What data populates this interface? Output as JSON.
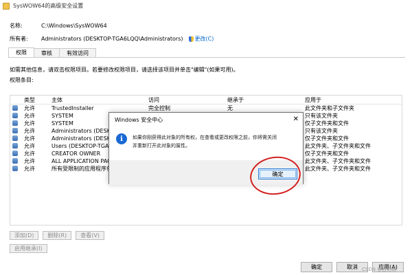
{
  "window": {
    "title": "SysWOW64的高级安全设置"
  },
  "props": {
    "name_label": "名称:",
    "name_value": "C:\\Windows\\SysWOW64",
    "owner_label": "所有者:",
    "owner_value": "Administrators (DESKTOP-TGA6LQQ\\Administrators)",
    "owner_change": "更改(C)"
  },
  "tabs": [
    "权限",
    "审核",
    "有效访问"
  ],
  "info_text": "如需其他信息，请双击权限项目。若要修改权限项目，请选择该项目并单击\"编辑\"(如果可用)。",
  "entries_label": "权限条目:",
  "table": {
    "headers": [
      "类型",
      "主体",
      "访问",
      "继承于",
      "应用于"
    ],
    "rows": [
      [
        "允许",
        "TrustedInstaller",
        "完全控制",
        "无",
        "此文件夹和子文件夹"
      ],
      [
        "允许",
        "SYSTEM",
        "",
        "",
        "只有该文件夹"
      ],
      [
        "允许",
        "SYSTEM",
        "",
        "",
        "仅子文件夹和文件"
      ],
      [
        "允许",
        "Administrators (DESKTOP-",
        "",
        "",
        "只有该文件夹"
      ],
      [
        "允许",
        "Administrators (DESKTOP-",
        "",
        "",
        "仅子文件夹和文件"
      ],
      [
        "允许",
        "Users (DESKTOP-TGA6",
        "",
        "",
        "此文件夹、子文件夹和文件"
      ],
      [
        "允许",
        "CREATOR OWNER",
        "",
        "",
        "仅子文件夹和文件"
      ],
      [
        "允许",
        "ALL APPLICATION PAC",
        "",
        "",
        "此文件夹、子文件夹和文件"
      ],
      [
        "允许",
        "所有受限制的应用程序包",
        "",
        "",
        "此文件夹、子文件夹和文件"
      ]
    ]
  },
  "buttons": {
    "add": "添加(D)",
    "remove": "删除(R)",
    "view": "查看(V)",
    "enable_inherit": "启用继承(I)",
    "ok": "确定",
    "cancel": "取消",
    "apply": "应用(A)"
  },
  "watermark": "CSDN @白忆萌",
  "dialog": {
    "title": "Windows 安全中心",
    "close": "✕",
    "message_line1": "如果你刚获得此对象的所有权，在查看或更改权限之前，你将需关闭",
    "message_line2": "并重新打开此对象的属性。",
    "ok": "确定"
  },
  "colors": {
    "link": "#0066cc",
    "dialog_accent": "#2a79d6",
    "annotation": "#d42020"
  }
}
